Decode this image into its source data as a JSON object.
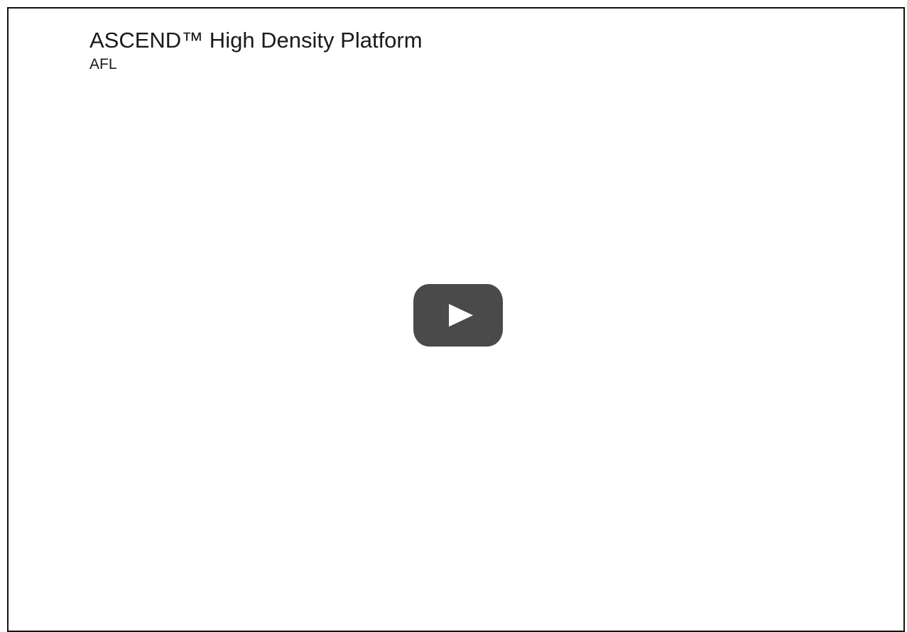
{
  "video": {
    "title": "ASCEND™ High Density Platform",
    "channel": "AFL"
  },
  "player": {
    "play_icon": "play-icon",
    "colors": {
      "play_button_bg": "#4a4a4a",
      "play_triangle": "#ffffff",
      "frame_border": "#111111"
    }
  }
}
